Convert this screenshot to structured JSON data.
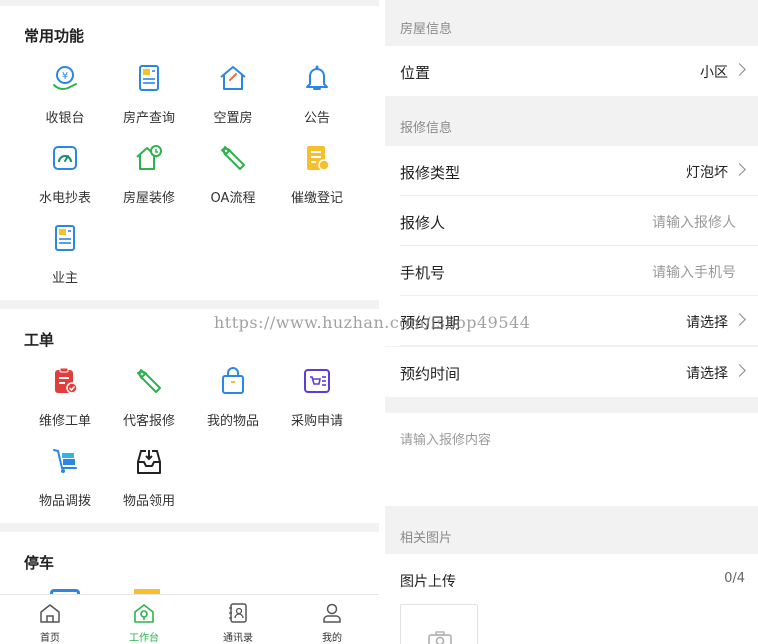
{
  "left": {
    "sections": [
      {
        "title": "常用功能",
        "items": [
          "收银台",
          "房产查询",
          "空置房",
          "公告",
          "水电抄表",
          "房屋装修",
          "OA流程",
          "催缴登记",
          "业主"
        ]
      },
      {
        "title": "工单",
        "items": [
          "维修工单",
          "代客报修",
          "我的物品",
          "采购申请",
          "物品调拨",
          "物品领用"
        ]
      },
      {
        "title": "停车"
      }
    ],
    "tabbar": [
      {
        "label": "首页",
        "icon": "home-icon"
      },
      {
        "label": "工作台",
        "icon": "workbench-icon",
        "active": true
      },
      {
        "label": "通讯录",
        "icon": "contacts-icon"
      },
      {
        "label": "我的",
        "icon": "profile-icon"
      }
    ]
  },
  "right": {
    "house_group": "房屋信息",
    "location": {
      "label": "位置",
      "value": "小区"
    },
    "repair_group": "报修信息",
    "repair_type": {
      "label": "报修类型",
      "value": "灯泡坏"
    },
    "reporter": {
      "label": "报修人",
      "placeholder": "请输入报修人"
    },
    "phone": {
      "label": "手机号",
      "placeholder": "请输入手机号"
    },
    "date": {
      "label": "预约日期",
      "value": "请选择"
    },
    "time": {
      "label": "预约时间",
      "value": "请选择"
    },
    "content_placeholder": "请输入报修内容",
    "photo_group": "相关图片",
    "upload": {
      "label": "图片上传",
      "count": "0/4"
    }
  },
  "watermark": "https://www.huzhan.com/ishop49544",
  "colors": {
    "accent": "#2eb24b",
    "blue": "#2b86e6",
    "yellow": "#f6c02c",
    "red": "#e23d3d",
    "purple": "#5b3ed6"
  }
}
